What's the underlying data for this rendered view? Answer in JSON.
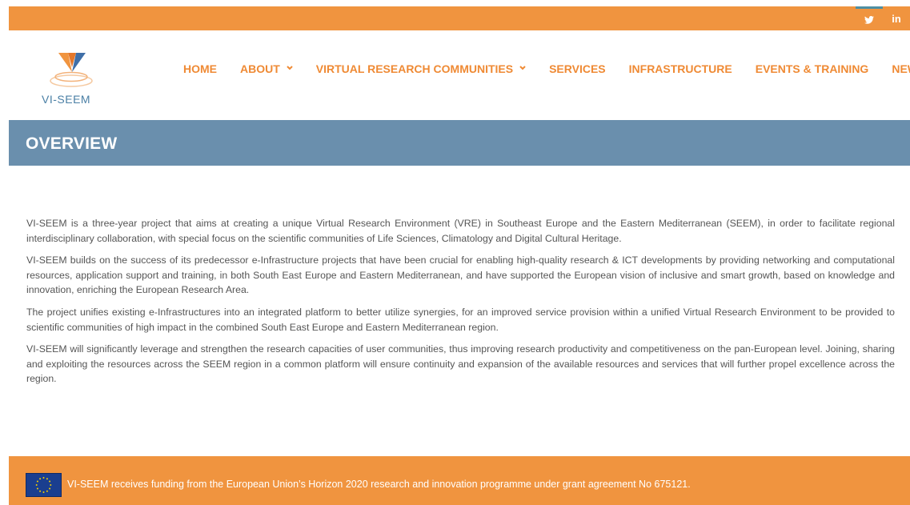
{
  "social": {
    "twitter_glyph": "🐦",
    "linkedin_label": "in"
  },
  "logo": {
    "text": "VI-SEEM",
    "colors": {
      "orange": "#f0943f",
      "blue": "#4a7fa5"
    }
  },
  "nav": {
    "items": [
      {
        "label": "HOME",
        "has_dropdown": false
      },
      {
        "label": "ABOUT",
        "has_dropdown": true
      },
      {
        "label": "VIRTUAL RESEARCH COMMUNITIES",
        "has_dropdown": true
      },
      {
        "label": "SERVICES",
        "has_dropdown": false
      },
      {
        "label": "INFRASTRUCTURE",
        "has_dropdown": false
      },
      {
        "label": "EVENTS & TRAINING",
        "has_dropdown": false
      },
      {
        "label": "NEWS",
        "has_dropdown": false
      }
    ],
    "dropdown_glyph": "⌄"
  },
  "page": {
    "title": "OVERVIEW"
  },
  "content": {
    "paragraphs": [
      "VI-SEEM is a three-year project that aims at creating a unique Virtual Research Environment (VRE) in Southeast Europe and the Eastern Mediterranean (SEEM), in order to facilitate regional interdisciplinary collaboration, with special focus on the scientific communities of Life Sciences, Climatology and Digital Cultural Heritage.",
      "VI-SEEM builds on the success of its predecessor e-Infrastructure projects that have been crucial for enabling high-quality research & ICT developments by providing networking and computational resources, application support and training, in both South East Europe and Eastern Mediterranean, and have supported the European vision of inclusive and smart growth, based on knowledge and innovation, enriching the European Research Area.",
      "The project unifies existing e-Infrastructures into an integrated platform to better utilize synergies, for an improved service provision within a unified Virtual Research Environment to be provided to scientific communities of high impact in the combined South East Europe and Eastern Mediterranean region.",
      "VI-SEEM will significantly leverage and strengthen the research capacities of user communities, thus improving research productivity and competitiveness on the pan-European level. Joining, sharing and exploiting the resources across the SEEM region in a common platform will ensure continuity and expansion of the available resources and services that will further propel excellence across the region."
    ]
  },
  "footer": {
    "text": "VI-SEEM receives funding from the European Union’s Horizon 2020 research and innovation programme under grant agreement No 675121."
  },
  "colors": {
    "accent_orange": "#f0943f",
    "nav_orange": "#ef8a34",
    "band_blue": "#6a8fad",
    "body_text": "#555555"
  }
}
